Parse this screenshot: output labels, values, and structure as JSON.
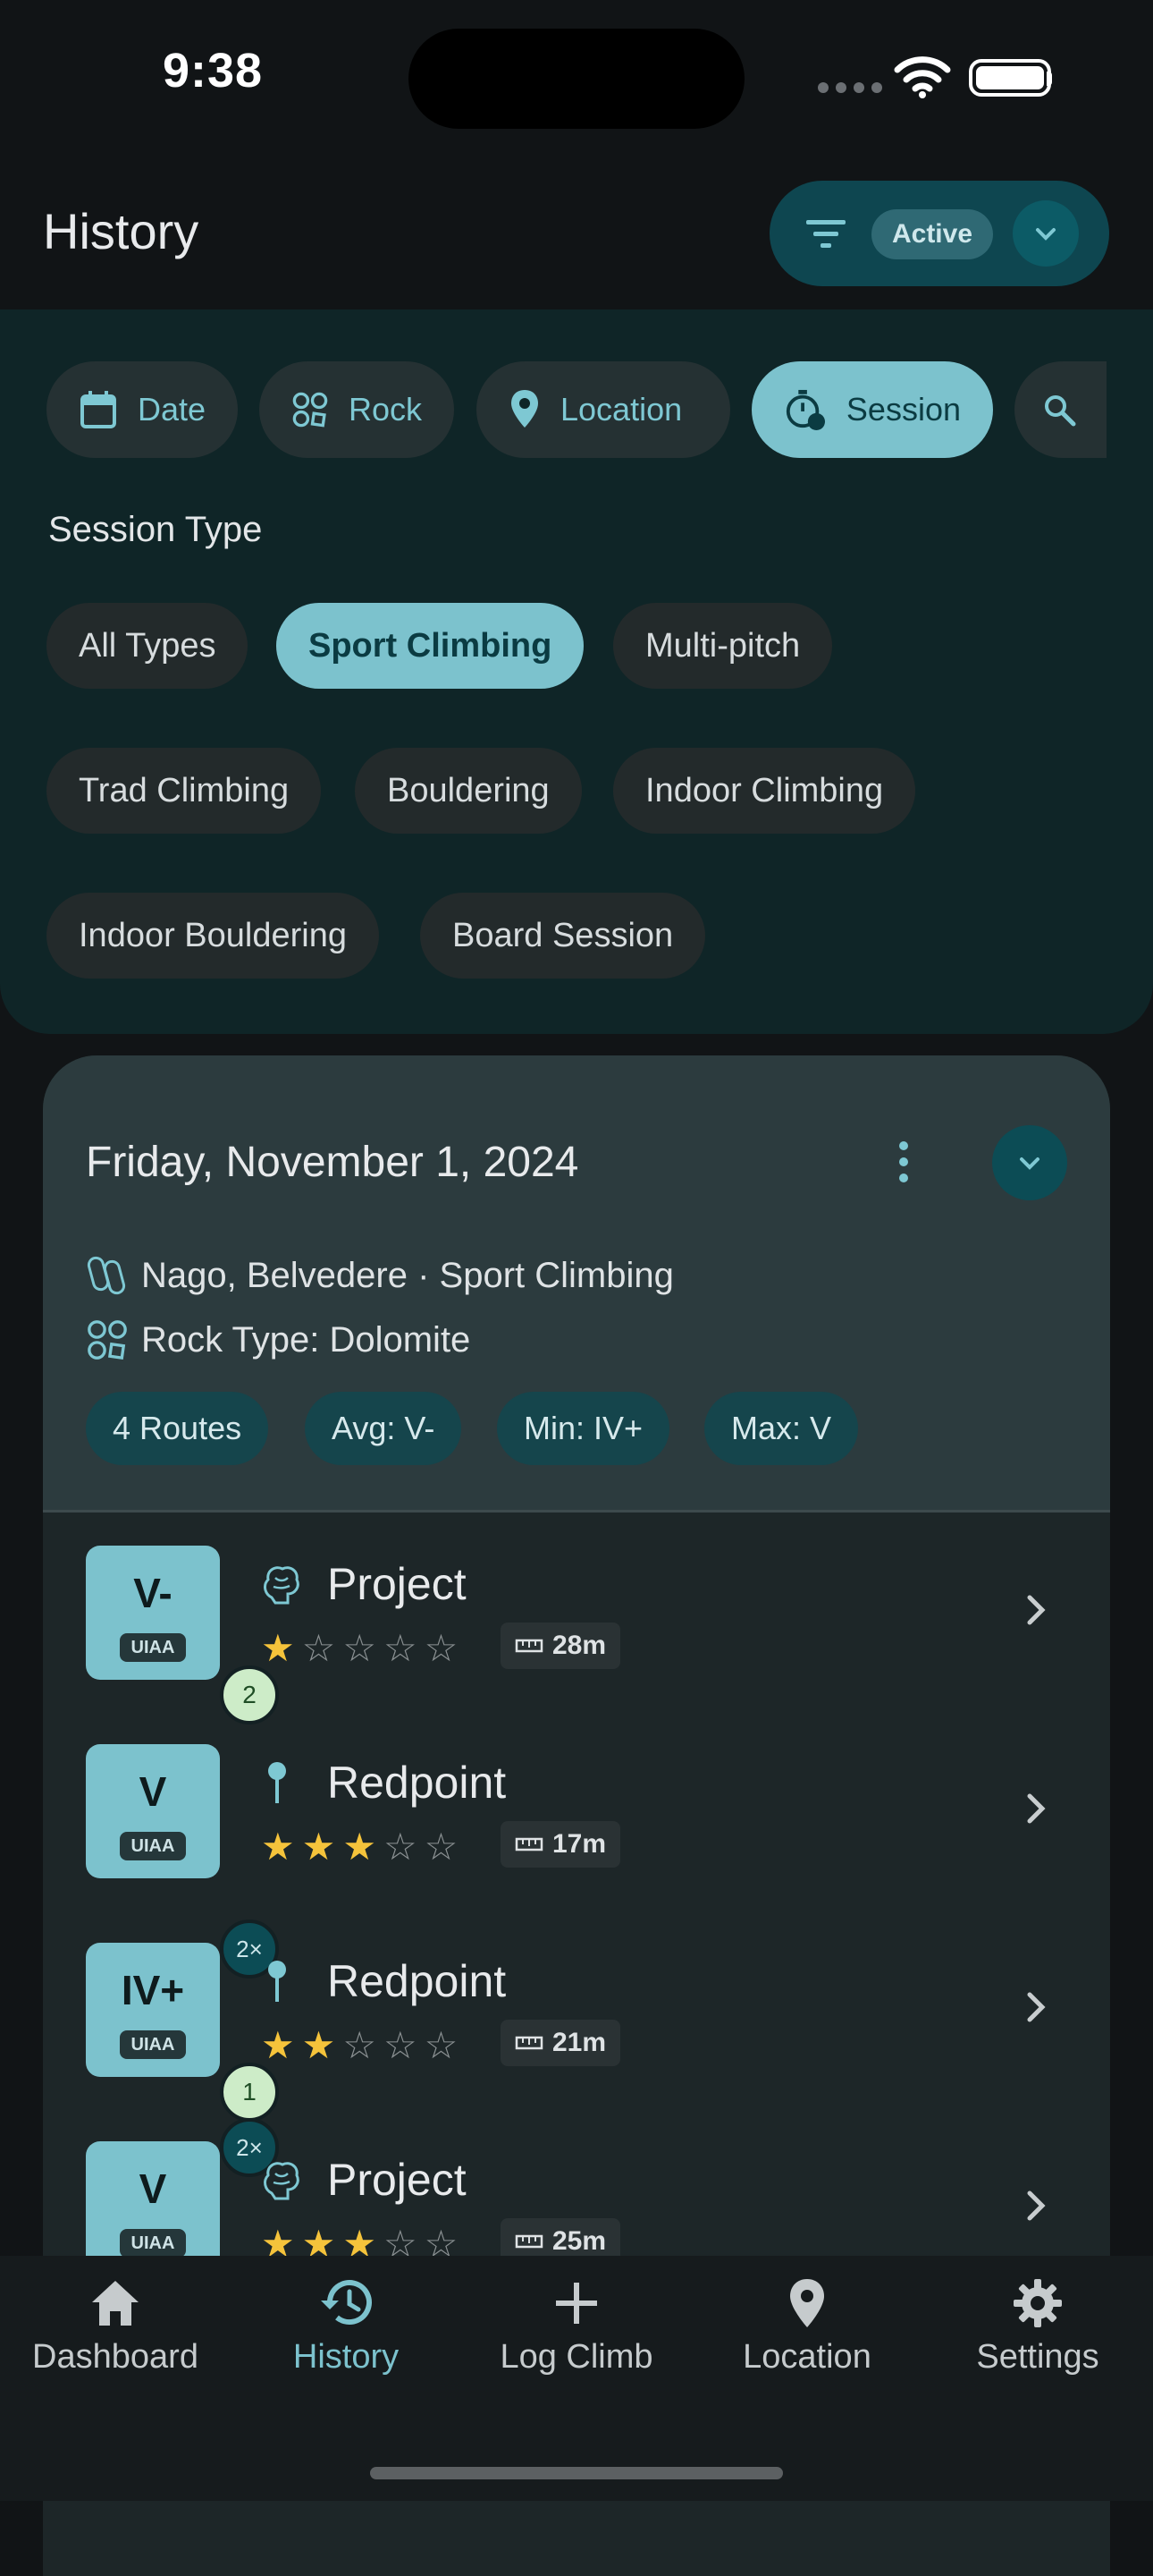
{
  "status_bar": {
    "time": "9:38"
  },
  "header": {
    "title": "History",
    "filter_badge": "Active"
  },
  "filter_tabs": [
    {
      "label": "Date",
      "icon": "calendar-icon",
      "selected": false
    },
    {
      "label": "Rock",
      "icon": "rock-icon",
      "selected": false
    },
    {
      "label": "Location",
      "icon": "location-pin-icon",
      "selected": false
    },
    {
      "label": "Session",
      "icon": "stopwatch-icon",
      "selected": true
    },
    {
      "label": "",
      "icon": "search-icon",
      "selected": false
    }
  ],
  "session_type": {
    "label": "Session Type",
    "options": [
      {
        "label": "All Types",
        "selected": false
      },
      {
        "label": "Sport Climbing",
        "selected": true
      },
      {
        "label": "Multi-pitch",
        "selected": false
      },
      {
        "label": "Trad Climbing",
        "selected": false
      },
      {
        "label": "Bouldering",
        "selected": false
      },
      {
        "label": "Indoor Climbing",
        "selected": false
      },
      {
        "label": "Indoor Bouldering",
        "selected": false
      },
      {
        "label": "Board Session",
        "selected": false
      }
    ]
  },
  "session_card": {
    "date": "Friday, November 1, 2024",
    "location_line": "Nago, Belvedere · Sport Climbing",
    "rock_line": "Rock Type: Dolomite",
    "stats": [
      "4 Routes",
      "Avg: V-",
      "Min: IV+",
      "Max: V"
    ]
  },
  "routes": [
    {
      "grade": "V-",
      "system": "UIAA",
      "tries": "2",
      "repeats": "",
      "type": "Project",
      "icon": "brain-icon",
      "stars": 1,
      "length": "28m"
    },
    {
      "grade": "V",
      "system": "UIAA",
      "tries": "",
      "repeats": "",
      "type": "Redpoint",
      "icon": "pin-icon",
      "stars": 3,
      "length": "17m"
    },
    {
      "grade": "IV+",
      "system": "UIAA",
      "tries": "1",
      "repeats": "2×",
      "type": "Redpoint",
      "icon": "pin-icon",
      "stars": 2,
      "length": "21m"
    },
    {
      "grade": "V",
      "system": "UIAA",
      "tries": "",
      "repeats": "2×",
      "type": "Project",
      "icon": "brain-icon",
      "stars": 3,
      "length": "25m"
    }
  ],
  "bottom_nav": [
    {
      "label": "Dashboard",
      "icon": "home-icon",
      "selected": false
    },
    {
      "label": "History",
      "icon": "history-icon",
      "selected": true
    },
    {
      "label": "Log Climb",
      "icon": "plus-icon",
      "selected": false
    },
    {
      "label": "Location",
      "icon": "location-pin-icon",
      "selected": false
    },
    {
      "label": "Settings",
      "icon": "gear-icon",
      "selected": false
    }
  ],
  "colors": {
    "accent": "#7cc2cd",
    "star": "#f5c33b",
    "background": "#111416"
  }
}
